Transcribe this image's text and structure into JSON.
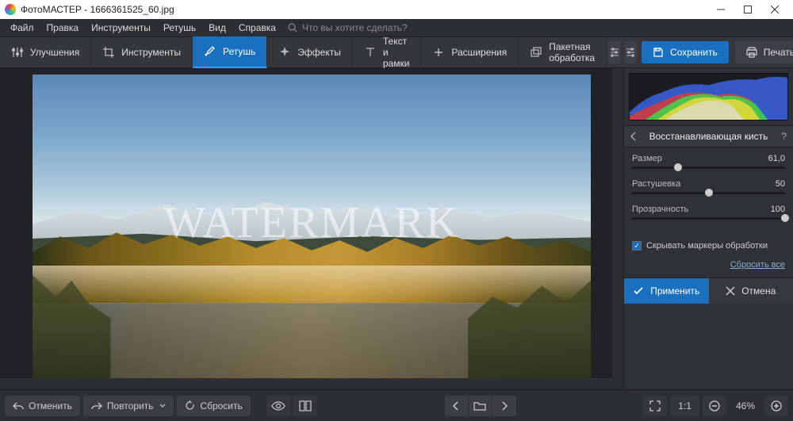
{
  "window": {
    "title": "ФотоМАСТЕР - 1666361525_60.jpg"
  },
  "menu": {
    "items": [
      "Файл",
      "Правка",
      "Инструменты",
      "Ретушь",
      "Вид",
      "Справка"
    ],
    "search_placeholder": "Что вы хотите сделать?"
  },
  "toolbar": {
    "enhance": "Улучшения",
    "tools": "Инструменты",
    "retouch": "Ретушь",
    "effects": "Эффекты",
    "text": "Текст и рамки",
    "extensions": "Расширения",
    "batch": "Пакетная обработка",
    "save": "Сохранить",
    "print": "Печать"
  },
  "canvas": {
    "watermark": "WATERMARK"
  },
  "panel": {
    "title": "Восстанавливающая кисть",
    "sliders": {
      "size": {
        "label": "Размер",
        "value": "61,0",
        "pos": 30
      },
      "feather": {
        "label": "Растушевка",
        "value": "50",
        "pos": 50
      },
      "opacity": {
        "label": "Прозрачность",
        "value": "100",
        "pos": 100
      }
    },
    "hide_markers": "Скрывать маркеры обработки",
    "reset": "Сбросить все",
    "apply": "Применить",
    "cancel": "Отмена"
  },
  "bottom": {
    "undo": "Отменить",
    "redo": "Повторить",
    "reset": "Сбросить",
    "ratio": "1:1",
    "zoom": "46%"
  }
}
